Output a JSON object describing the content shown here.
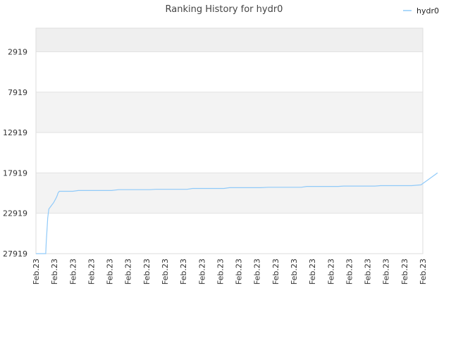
{
  "chart_data": {
    "type": "line",
    "title": "Ranking History for hydr0",
    "legend": {
      "position": "top-right",
      "entries": [
        "hydr0"
      ]
    },
    "xlabel": "",
    "ylabel": "",
    "y_inverted": true,
    "ylim": [
      27919,
      0
    ],
    "y_ticks": [
      2919,
      7919,
      12919,
      17919,
      22919,
      27919
    ],
    "x_tick_labels": [
      "Feb.23",
      "Feb.23",
      "Feb.23",
      "Feb.23",
      "Feb.23",
      "Feb.23",
      "Feb.23",
      "Feb.23",
      "Feb.23",
      "Feb.23",
      "Feb.23",
      "Feb.23",
      "Feb.23",
      "Feb.23",
      "Feb.23",
      "Feb.23",
      "Feb.23",
      "Feb.23",
      "Feb.23",
      "Feb.23",
      "Feb.23",
      "Feb.23"
    ],
    "grid": true,
    "series": [
      {
        "name": "hydr0",
        "color": "#90caf9",
        "x": [
          0,
          0.53,
          0.53,
          0.56,
          0.6,
          0.64,
          0.7,
          0.76,
          0.86,
          0.96,
          1.1,
          1.16,
          1.2,
          1.27,
          1.3,
          2.0,
          2.3,
          4.1,
          4.5,
          6.2,
          6.5,
          8.2,
          8.5,
          10.2,
          10.5,
          12.2,
          12.6,
          14.4,
          14.7,
          16.4,
          16.7,
          18.4,
          18.7,
          20.4,
          20.9,
          21.8
        ],
        "y": [
          27919,
          27919,
          27919,
          26500,
          25000,
          23500,
          22400,
          22200,
          21900,
          21600,
          21000,
          20700,
          20400,
          20200,
          20200,
          20200,
          20100,
          20100,
          20000,
          20000,
          19950,
          19950,
          19850,
          19850,
          19750,
          19750,
          19700,
          19700,
          19600,
          19600,
          19550,
          19550,
          19500,
          19500,
          19400,
          17919
        ]
      }
    ]
  }
}
